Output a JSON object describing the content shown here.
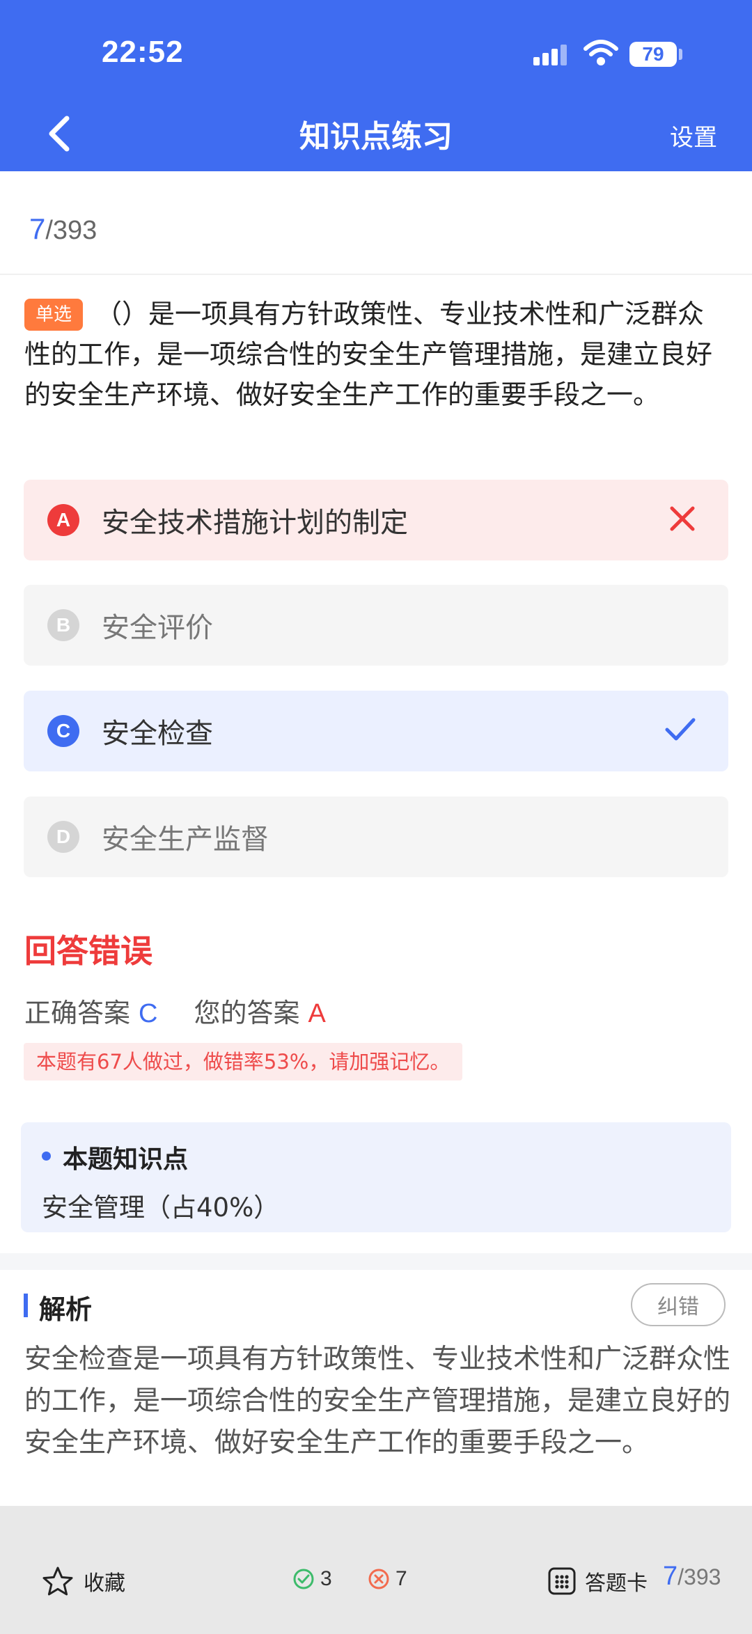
{
  "status_bar": {
    "time": "22:52",
    "battery": "79"
  },
  "nav": {
    "title": "知识点练习",
    "settings_label": "设置"
  },
  "progress": {
    "current": "7",
    "total": "/393"
  },
  "question": {
    "type_tag": "单选",
    "text": "（）是一项具有方针政策性、专业技术性和广泛群众性的工作，是一项综合性的安全生产管理措施，是建立良好的安全生产环境、做好安全生产工作的重要手段之一。"
  },
  "options": [
    {
      "letter": "A",
      "text": "安全技术措施计划的制定",
      "state": "wrong"
    },
    {
      "letter": "B",
      "text": "安全评价",
      "state": "neutral"
    },
    {
      "letter": "C",
      "text": "安全检查",
      "state": "correct"
    },
    {
      "letter": "D",
      "text": "安全生产监督",
      "state": "neutral"
    }
  ],
  "result": {
    "title": "回答错误",
    "correct_label": "正确答案",
    "correct_value": "C",
    "your_label": "您的答案",
    "your_value": "A",
    "stats_text": "本题有67人做过，做错率53%，请加强记忆。"
  },
  "knowledge": {
    "title": "本题知识点",
    "value": "安全管理（占40%）"
  },
  "analysis": {
    "title": "解析",
    "report_label": "纠错",
    "text": "安全检查是一项具有方针政策性、专业技术性和广泛群众性的工作，是一项综合性的安全生产管理措施，是建立良好的安全生产环境、做好安全生产工作的重要手段之一。"
  },
  "bottom_bar": {
    "favorite_label": "收藏",
    "correct_count": "3",
    "wrong_count": "7",
    "answer_card_label": "答题卡",
    "progress_current": "7",
    "progress_total": "/393"
  },
  "colors": {
    "primary": "#3F6CF1",
    "error": "#EE3B3B",
    "tag": "#FF7A3D"
  }
}
